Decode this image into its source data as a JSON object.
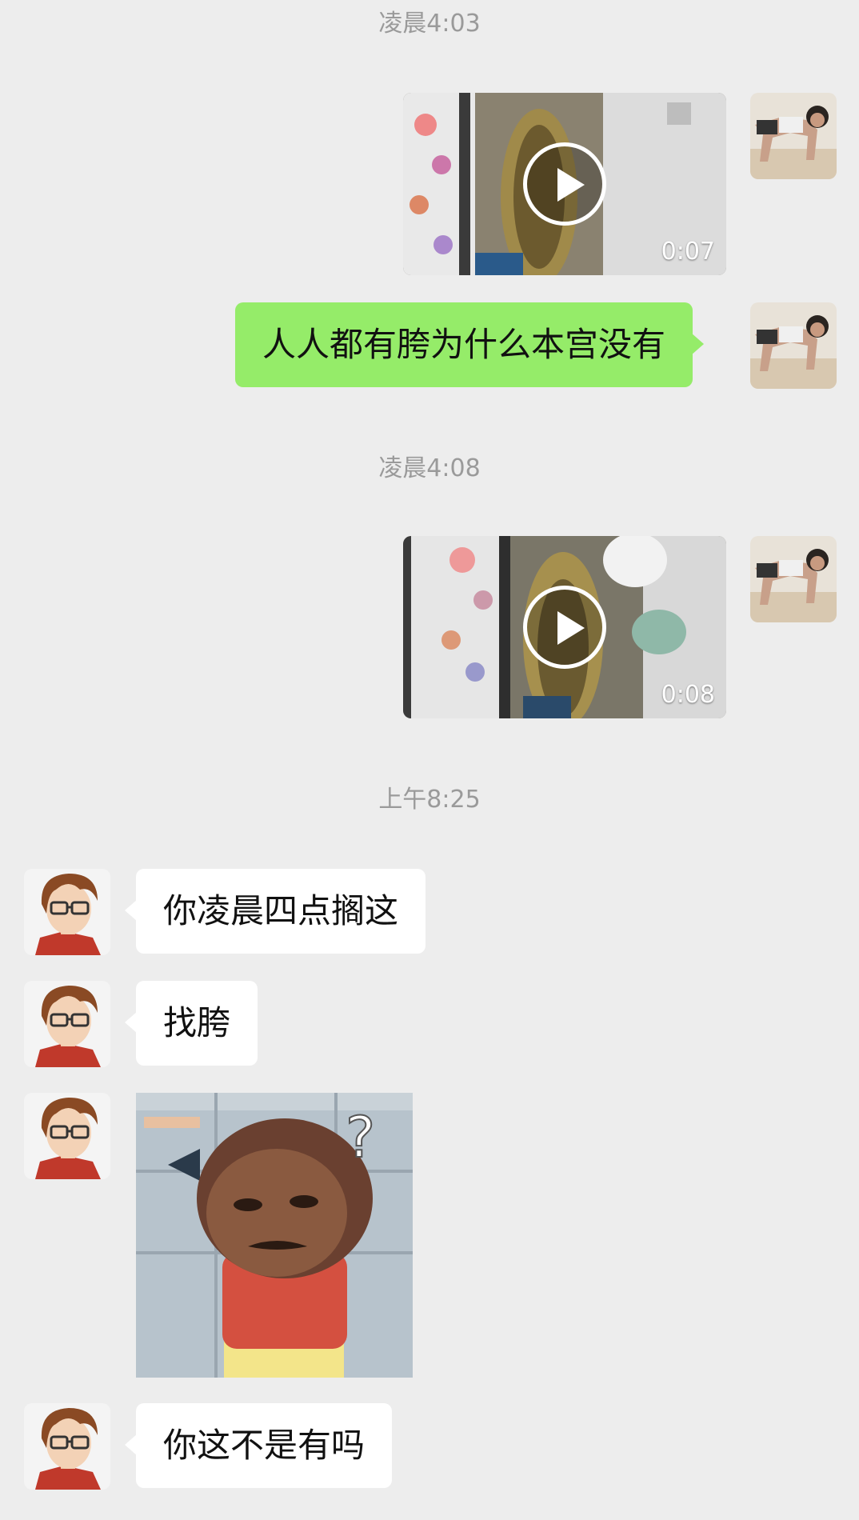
{
  "timestamps": [
    "凌晨4:03",
    "凌晨4:08",
    "上午8:25"
  ],
  "messages": {
    "video1": {
      "duration": "0:07"
    },
    "text1": "人人都有胯为什么本宫没有",
    "video2": {
      "duration": "0:08"
    },
    "reply1": "你凌晨四点搁这",
    "reply2": "找胯",
    "reply3": "你这不是有吗"
  },
  "sticker": {
    "overlay": "?"
  },
  "colors": {
    "background": "#ededed",
    "sent_bubble": "#95ec69",
    "received_bubble": "#ffffff",
    "timestamp_text": "#9a9a9a"
  }
}
